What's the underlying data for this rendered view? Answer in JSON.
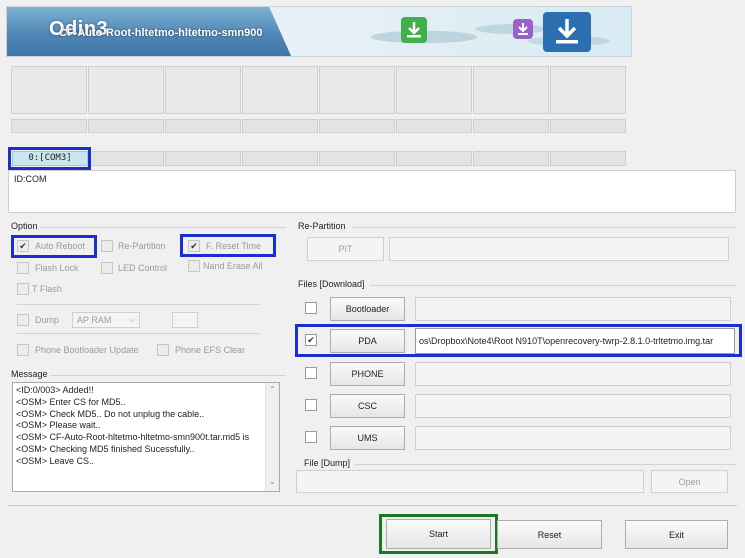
{
  "banner": {
    "app_name": "Odin3",
    "file_title": "CF-Auto-Root-hltetmo-hltetmo-smn900",
    "icons": [
      "download-green-icon",
      "download-purple-icon",
      "download-blue-icon"
    ]
  },
  "slots": {
    "com_label": "0:[COM3]",
    "id_com": "ID:COM"
  },
  "option": {
    "title": "Option",
    "auto_reboot": "Auto Reboot",
    "re_partition": "Re-Partition",
    "f_reset_time": "F. Reset Time",
    "flash_lock": "Flash Lock",
    "led_control": "LED Control",
    "nand_erase_all": "Nand Erase All",
    "t_flash": "T Flash",
    "dump": "Dump",
    "dump_select": "AP RAM",
    "phone_bootloader_update": "Phone Bootloader Update",
    "phone_efs_clear": "Phone EFS Clear",
    "check_mark": "✔"
  },
  "message": {
    "title": "Message",
    "lines": [
      "<ID:0/003> Added!!",
      "<OSM> Enter CS for MD5..",
      "<OSM> Check MD5.. Do not unplug the cable..",
      "<OSM> Please wait..",
      "<OSM> CF-Auto-Root-hltetmo-hltetmo-smn900t.tar.md5 is",
      "<OSM> Checking MD5 finished Sucessfully..",
      "<OSM> Leave CS.."
    ]
  },
  "repartition": {
    "title": "Re-Partition",
    "pit": "PIT"
  },
  "files": {
    "title": "Files [Download]",
    "bootloader": "Bootloader",
    "pda": "PDA",
    "pda_path": "os\\Dropbox\\Note4\\Root N910T\\openrecovery-twrp-2.8.1.0-trltetmo.img.tar",
    "phone": "PHONE",
    "csc": "CSC",
    "ums": "UMS"
  },
  "dump": {
    "title": "File [Dump]",
    "open": "Open"
  },
  "footer": {
    "start": "Start",
    "reset": "Reset",
    "exit": "Exit"
  },
  "colors": {
    "highlight_blue": "#1a2fd0",
    "highlight_green": "#1b7a21",
    "com_slot": "#c9e6ee"
  }
}
